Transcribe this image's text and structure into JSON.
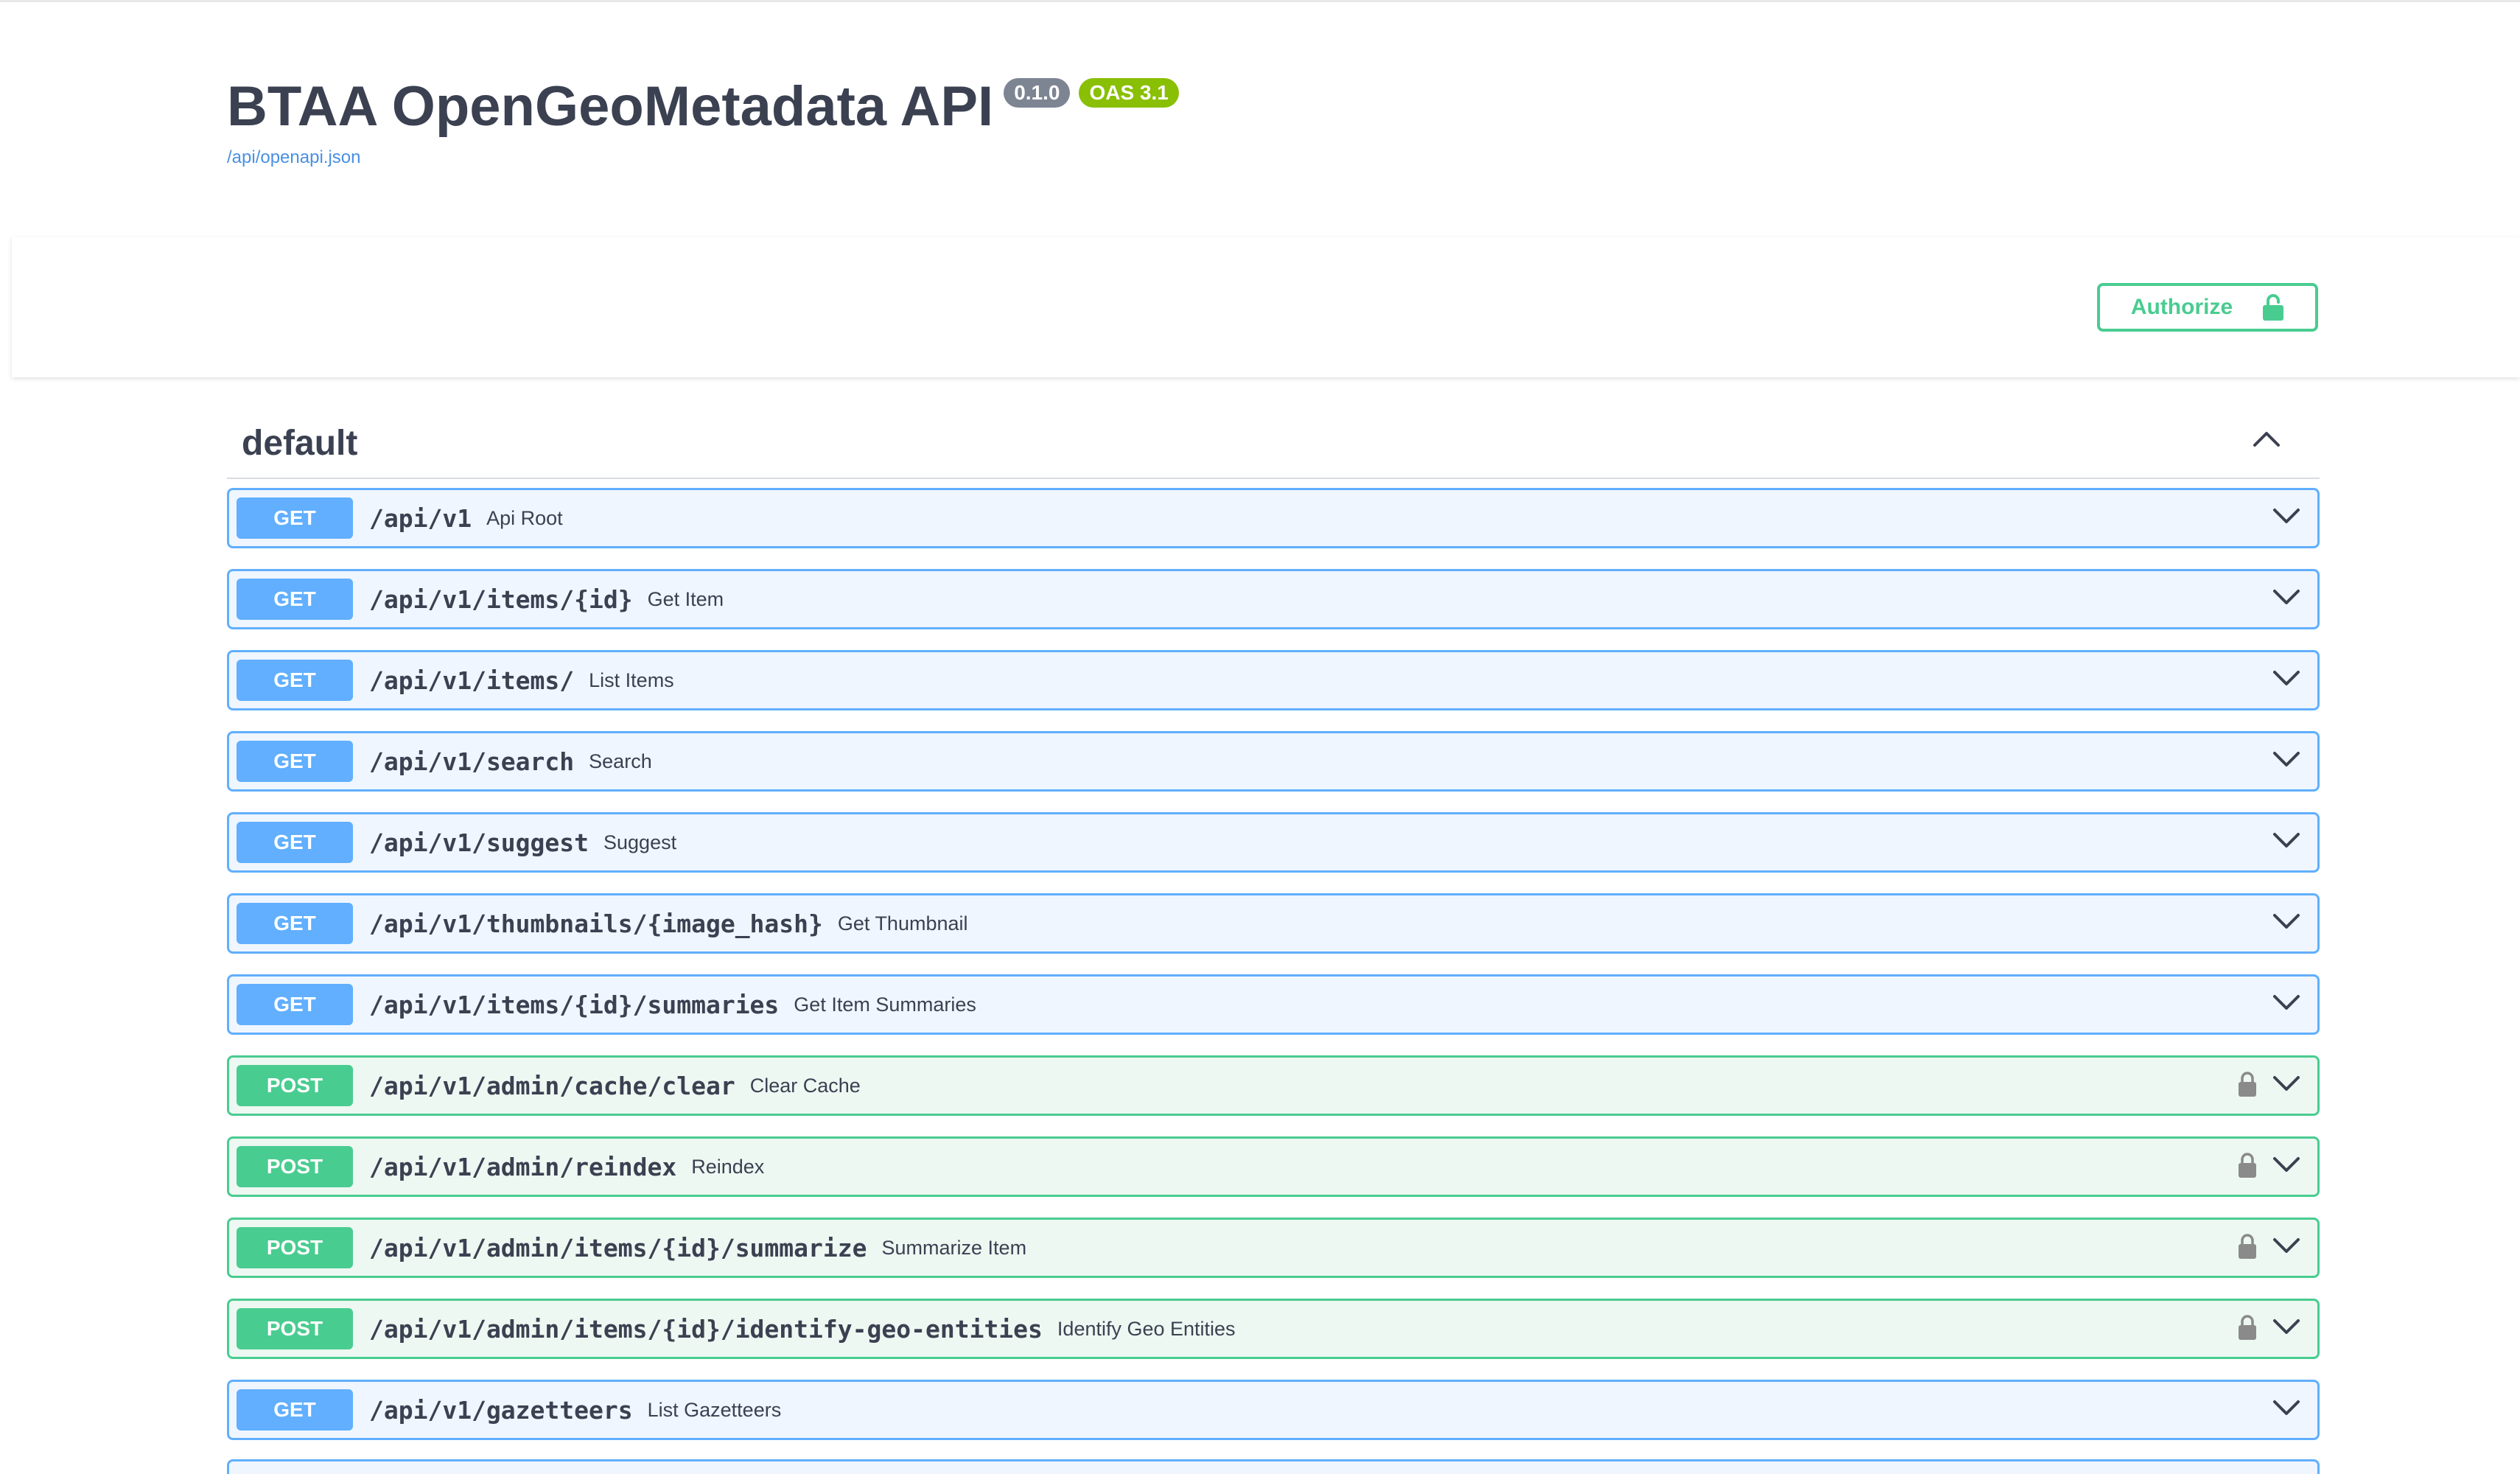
{
  "info": {
    "title": "BTAA OpenGeoMetadata API",
    "version": "0.1.0",
    "oas_version": "OAS 3.1",
    "spec_url": "/api/openapi.json"
  },
  "auth": {
    "authorize_label": "Authorize",
    "icon": "lock-open-icon"
  },
  "section": {
    "name": "default",
    "expanded": true
  },
  "colors": {
    "get": "#61affe",
    "post": "#49cc90",
    "badge_version": "#7d8492",
    "badge_oas": "#89bf04"
  },
  "operations": [
    {
      "method": "GET",
      "path": "/api/v1",
      "summary": "Api Root",
      "locked": false
    },
    {
      "method": "GET",
      "path": "/api/v1/items/{id}",
      "summary": "Get Item",
      "locked": false
    },
    {
      "method": "GET",
      "path": "/api/v1/items/",
      "summary": "List Items",
      "locked": false
    },
    {
      "method": "GET",
      "path": "/api/v1/search",
      "summary": "Search",
      "locked": false
    },
    {
      "method": "GET",
      "path": "/api/v1/suggest",
      "summary": "Suggest",
      "locked": false
    },
    {
      "method": "GET",
      "path": "/api/v1/thumbnails/{image_hash}",
      "summary": "Get Thumbnail",
      "locked": false
    },
    {
      "method": "GET",
      "path": "/api/v1/items/{id}/summaries",
      "summary": "Get Item Summaries",
      "locked": false
    },
    {
      "method": "POST",
      "path": "/api/v1/admin/cache/clear",
      "summary": "Clear Cache",
      "locked": true
    },
    {
      "method": "POST",
      "path": "/api/v1/admin/reindex",
      "summary": "Reindex",
      "locked": true
    },
    {
      "method": "POST",
      "path": "/api/v1/admin/items/{id}/summarize",
      "summary": "Summarize Item",
      "locked": true
    },
    {
      "method": "POST",
      "path": "/api/v1/admin/items/{id}/identify-geo-entities",
      "summary": "Identify Geo Entities",
      "locked": true
    },
    {
      "method": "GET",
      "path": "/api/v1/gazetteers",
      "summary": "List Gazetteers",
      "locked": false
    }
  ]
}
